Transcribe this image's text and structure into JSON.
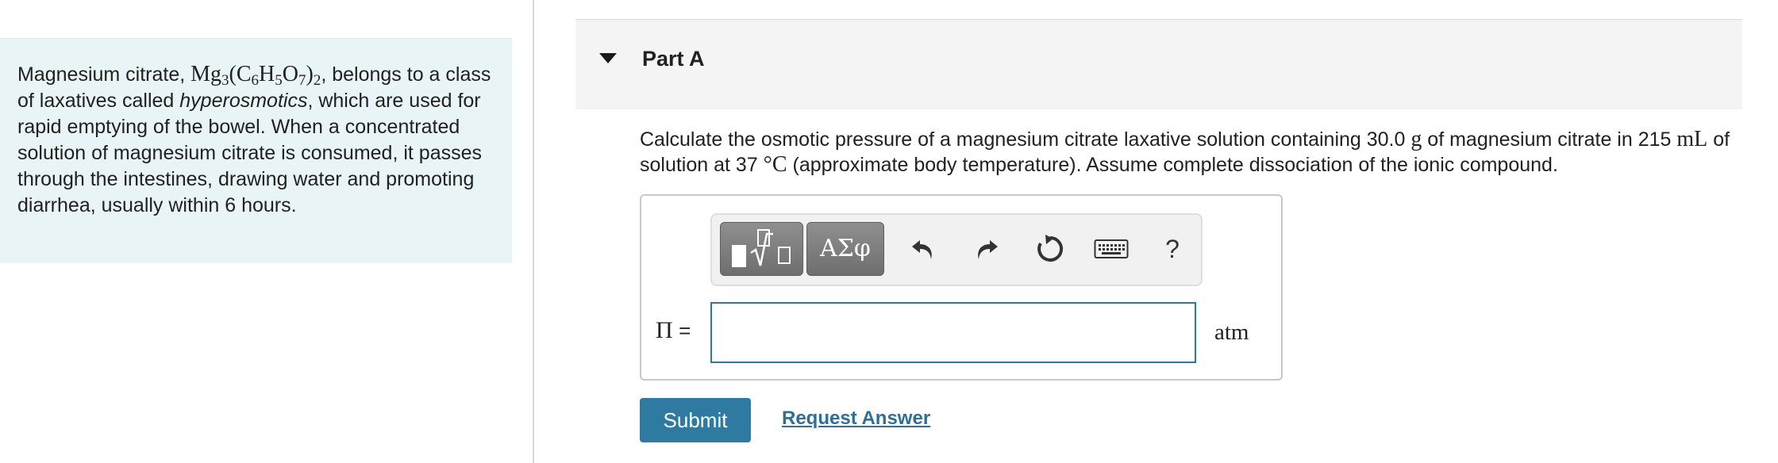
{
  "intro": {
    "text_1": "Magnesium citrate, ",
    "formula": {
      "mg": "Mg",
      "mg_sub": "3",
      "open": "(C",
      "c_sub": "6",
      "h": "H",
      "h_sub": "5",
      "o": "O",
      "o_sub": "7",
      "close": ")",
      "outer_sub": "2"
    },
    "text_2": ", belongs to a class of laxatives called ",
    "italic": "hyperosmotics",
    "text_3": ", which are used for rapid emptying of the bowel. When a concentrated solution of magnesium citrate is consumed, it passes through the intestines, drawing water and promoting diarrhea, usually within 6 hours."
  },
  "part": {
    "title": "Part A"
  },
  "question": {
    "text_1": "Calculate the osmotic pressure of a magnesium citrate laxative solution containing 30.0 ",
    "unit_g": "g",
    "text_2": " of magnesium citrate in 215 ",
    "unit_ml": "mL",
    "text_3": " of solution at 37 ",
    "unit_degc": "°C",
    "text_4": " (approximate body temperature). Assume complete dissociation of the ionic compound."
  },
  "toolbar": {
    "greek_label": "ΑΣφ",
    "help_label": "?"
  },
  "answer": {
    "symbol": "Π",
    "equals": "=",
    "value": "",
    "unit": "atm"
  },
  "actions": {
    "submit_label": "Submit",
    "request_label": "Request Answer"
  },
  "colors": {
    "intro_bg": "#e9f4f7",
    "header_bg": "#f4f4f4",
    "submit_bg": "#2f7aa0",
    "link": "#2f6f95",
    "input_border": "#2e7a96"
  },
  "icons": [
    "caret-down-icon",
    "templates-icon",
    "undo-icon",
    "redo-icon",
    "reset-icon",
    "keyboard-icon"
  ]
}
